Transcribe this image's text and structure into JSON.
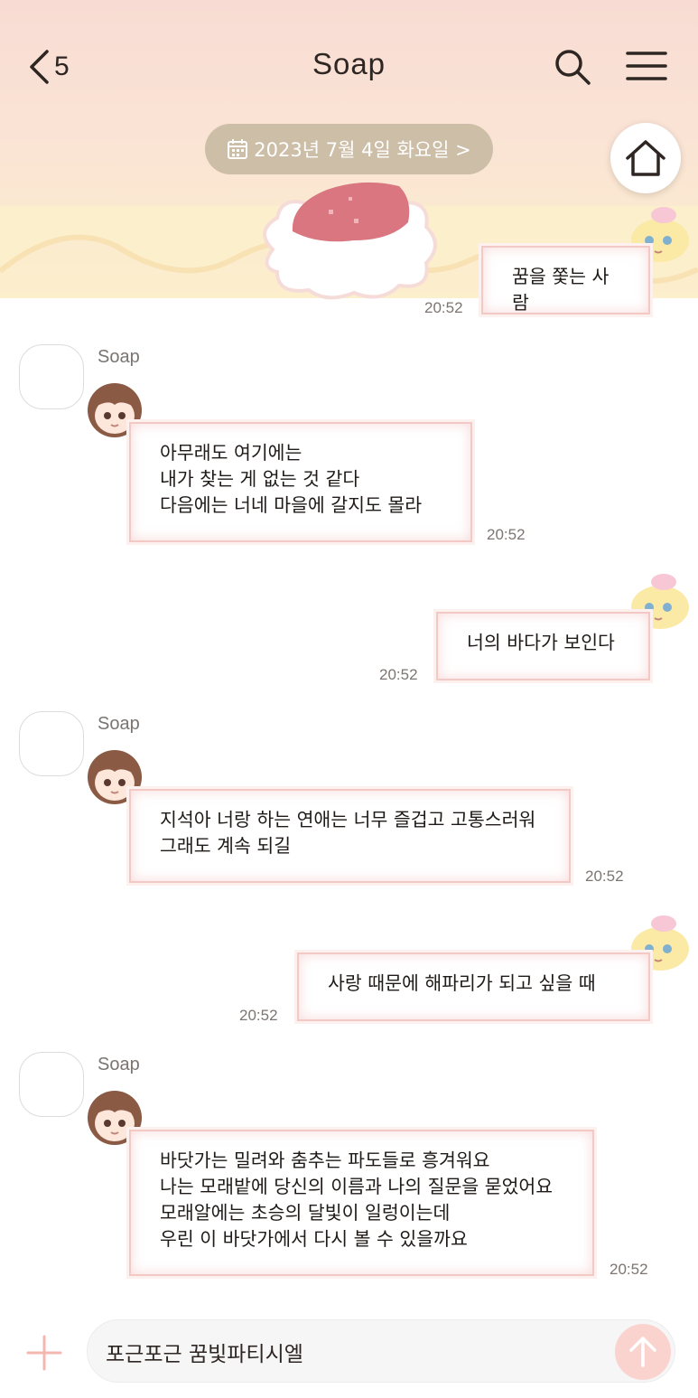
{
  "header": {
    "back_count": "5",
    "title": "Soap"
  },
  "date_banner": {
    "label": "2023년 7월 4일 화요일 >"
  },
  "colors": {
    "header_top": "#f8dcd3",
    "header_bottom": "#fcefcc",
    "bubble_border": "#f3c9c6",
    "date_pill": "#cdbea8",
    "send_button": "#fad3cf"
  },
  "messages": [
    {
      "side": "right",
      "text": "꿈을 쫓는 사람",
      "time": "20:52"
    },
    {
      "side": "left",
      "sender": "Soap",
      "text": "아무래도 여기에는\n내가 찾는 게 없는 것 같다\n다음에는 너네 마을에 갈지도 몰라",
      "time": "20:52"
    },
    {
      "side": "right",
      "text": "너의 바다가 보인다",
      "time": "20:52"
    },
    {
      "side": "left",
      "sender": "Soap",
      "text": "지석아 너랑 하는 연애는 너무 즐겁고 고통스러워\n그래도 계속 되길",
      "time": "20:52"
    },
    {
      "side": "right",
      "text": "사랑 때문에 해파리가 되고 싶을 때",
      "time": "20:52"
    },
    {
      "side": "left",
      "sender": "Soap",
      "text": "바닷가는 밀려와 춤추는 파도들로 흥겨워요\n나는 모래밭에 당신의 이름과 나의 질문을 묻었어요\n모래알에는 초승의 달빛이 일렁이는데\n우린 이 바닷가에서 다시 볼 수 있을까요",
      "time": "20:52"
    }
  ],
  "composer": {
    "input_value": "포근포근 꿈빛파티시엘"
  },
  "icons": [
    "back-chevron-icon",
    "search-icon",
    "menu-icon",
    "calendar-icon",
    "home-icon",
    "plus-icon",
    "send-arrow-icon"
  ]
}
